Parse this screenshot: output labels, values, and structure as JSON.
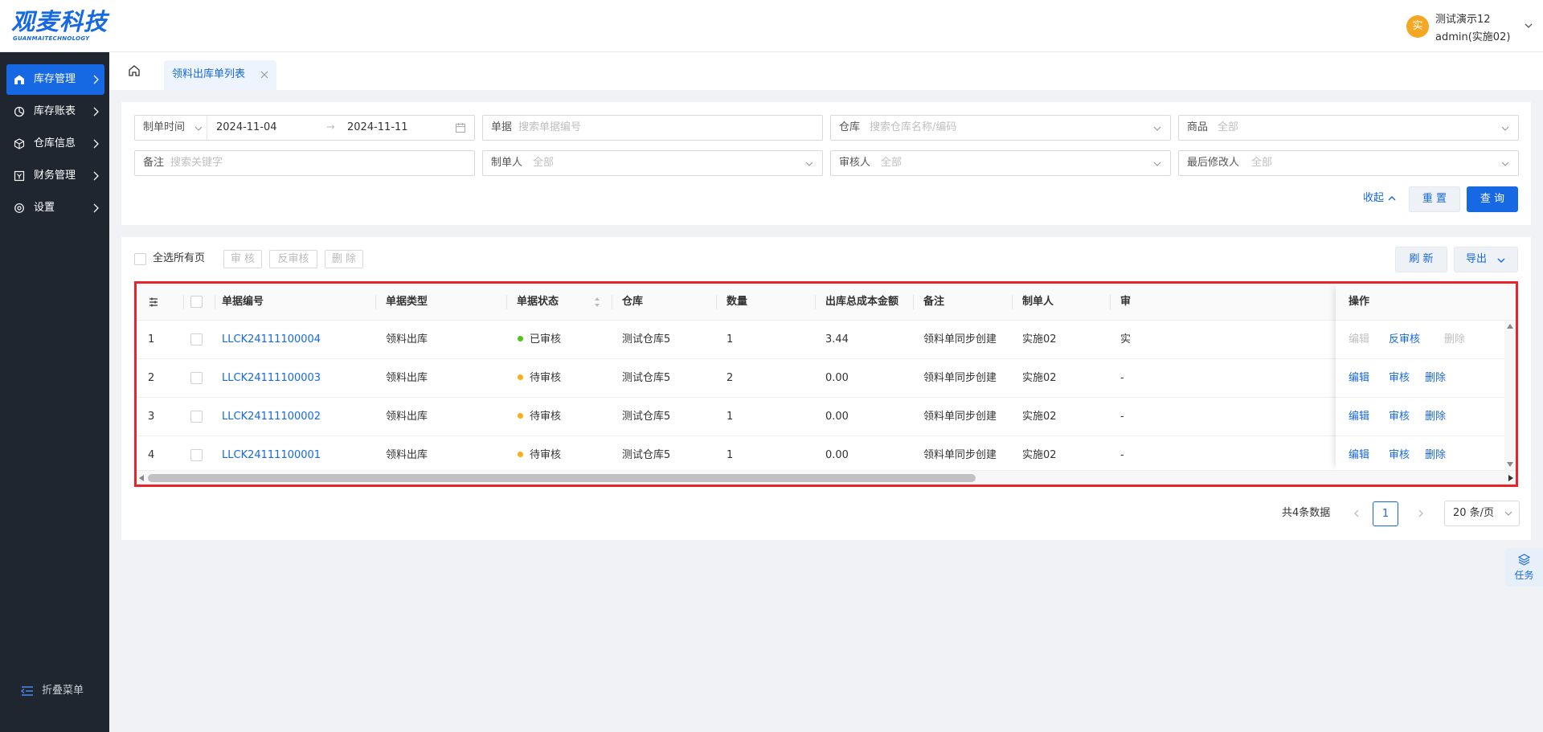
{
  "app": {
    "logo_main": "观麦科技",
    "logo_sub": "GUANMAITECHNOLOGY"
  },
  "user": {
    "avatar_text": "实",
    "name": "测试演示12",
    "role": "admin(实施02)"
  },
  "sidebar": {
    "items": [
      {
        "label": "库存管理",
        "icon": "warehouse-home-icon",
        "active": true
      },
      {
        "label": "库存账表",
        "icon": "pie-chart-icon"
      },
      {
        "label": "仓库信息",
        "icon": "cube-icon"
      },
      {
        "label": "财务管理",
        "icon": "finance-box-icon"
      },
      {
        "label": "设置",
        "icon": "gear-icon"
      }
    ],
    "collapse_label": "折叠菜单"
  },
  "tabs": {
    "active_label": "领料出库单列表"
  },
  "filters": {
    "date_type": "制单时间",
    "date_start": "2024-11-04",
    "date_end": "2024-11-11",
    "doc_label": "单据",
    "doc_placeholder": "搜索单据编号",
    "warehouse_label": "仓库",
    "warehouse_placeholder": "搜索仓库名称/编码",
    "product_label": "商品",
    "product_value": "全部",
    "remark_label": "备注",
    "remark_placeholder": "搜索关键字",
    "creator_label": "制单人",
    "creator_value": "全部",
    "auditor_label": "审核人",
    "auditor_value": "全部",
    "modifier_label": "最后修改人",
    "modifier_value": "全部",
    "collapse_label": "收起",
    "reset_label": "重 置",
    "query_label": "查 询"
  },
  "toolbar": {
    "select_all_label": "全选所有页",
    "audit_label": "审 核",
    "unaudit_label": "反审核",
    "delete_label": "删 除",
    "refresh_label": "刷 新",
    "export_label": "导出"
  },
  "table": {
    "headers": {
      "doc_no": "单据编号",
      "doc_type": "单据类型",
      "doc_status": "单据状态",
      "warehouse": "仓库",
      "quantity": "数量",
      "total_cost": "出库总成本金额",
      "remark": "备注",
      "creator": "制单人",
      "auditor": "审",
      "actions": "操作"
    },
    "rows": [
      {
        "index": "1",
        "doc_no": "LLCK24111100004",
        "doc_type": "领料出库",
        "status": "已审核",
        "status_color": "#52c41a",
        "warehouse": "测试仓库5",
        "quantity": "1",
        "total_cost": "3.44",
        "remark": "领料单同步创建",
        "creator": "实施02",
        "auditor": "实",
        "op1": "编辑",
        "op2": "反审核",
        "op3": "删除"
      },
      {
        "index": "2",
        "doc_no": "LLCK24111100003",
        "doc_type": "领料出库",
        "status": "待审核",
        "status_color": "#faad14",
        "warehouse": "测试仓库5",
        "quantity": "2",
        "total_cost": "0.00",
        "remark": "领料单同步创建",
        "creator": "实施02",
        "auditor": "-",
        "op1": "编辑",
        "op2": "审核",
        "op3": "删除"
      },
      {
        "index": "3",
        "doc_no": "LLCK24111100002",
        "doc_type": "领料出库",
        "status": "待审核",
        "status_color": "#faad14",
        "warehouse": "测试仓库5",
        "quantity": "1",
        "total_cost": "0.00",
        "remark": "领料单同步创建",
        "creator": "实施02",
        "auditor": "-",
        "op1": "编辑",
        "op2": "审核",
        "op3": "删除"
      },
      {
        "index": "4",
        "doc_no": "LLCK24111100001",
        "doc_type": "领料出库",
        "status": "待审核",
        "status_color": "#faad14",
        "warehouse": "测试仓库5",
        "quantity": "1",
        "total_cost": "0.00",
        "remark": "领料单同步创建",
        "creator": "实施02",
        "auditor": "-",
        "op1": "编辑",
        "op2": "审核",
        "op3": "删除"
      }
    ]
  },
  "pagination": {
    "total_text": "共4条数据",
    "current_page": "1",
    "page_size": "20 条/页"
  },
  "float_task": {
    "label": "任务"
  },
  "colors": {
    "primary": "#1668e3",
    "sidebar_bg": "#1f2630",
    "highlight_border": "#e8232b"
  }
}
